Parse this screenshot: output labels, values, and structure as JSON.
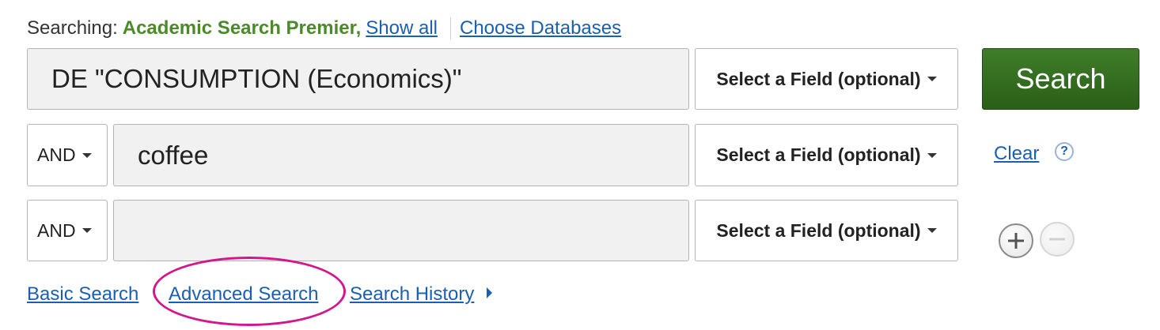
{
  "header": {
    "searching_label": "Searching:",
    "database_name": "Academic Search Premier,",
    "show_all": "Show all",
    "choose_databases": "Choose Databases"
  },
  "rows": [
    {
      "operator": null,
      "query": "DE \"CONSUMPTION (Economics)\"",
      "field": "Select a Field (optional)"
    },
    {
      "operator": "AND",
      "query": "coffee",
      "field": "Select a Field (optional)"
    },
    {
      "operator": "AND",
      "query": "",
      "field": "Select a Field (optional)"
    }
  ],
  "actions": {
    "search_label": "Search",
    "clear_label": "Clear",
    "help_glyph": "?"
  },
  "footer_links": {
    "basic_search": "Basic Search",
    "advanced_search": "Advanced Search",
    "search_history": "Search History"
  },
  "colors": {
    "brand_green": "#3f7d2a",
    "link_blue": "#1b5fb4",
    "highlight_magenta": "#d4168c"
  },
  "icons": {
    "add_row": "plus-circle-icon",
    "remove_row": "minus-circle-icon",
    "help": "question-circle-icon",
    "dropdown": "caret-down-icon",
    "history": "caret-right-icon"
  }
}
